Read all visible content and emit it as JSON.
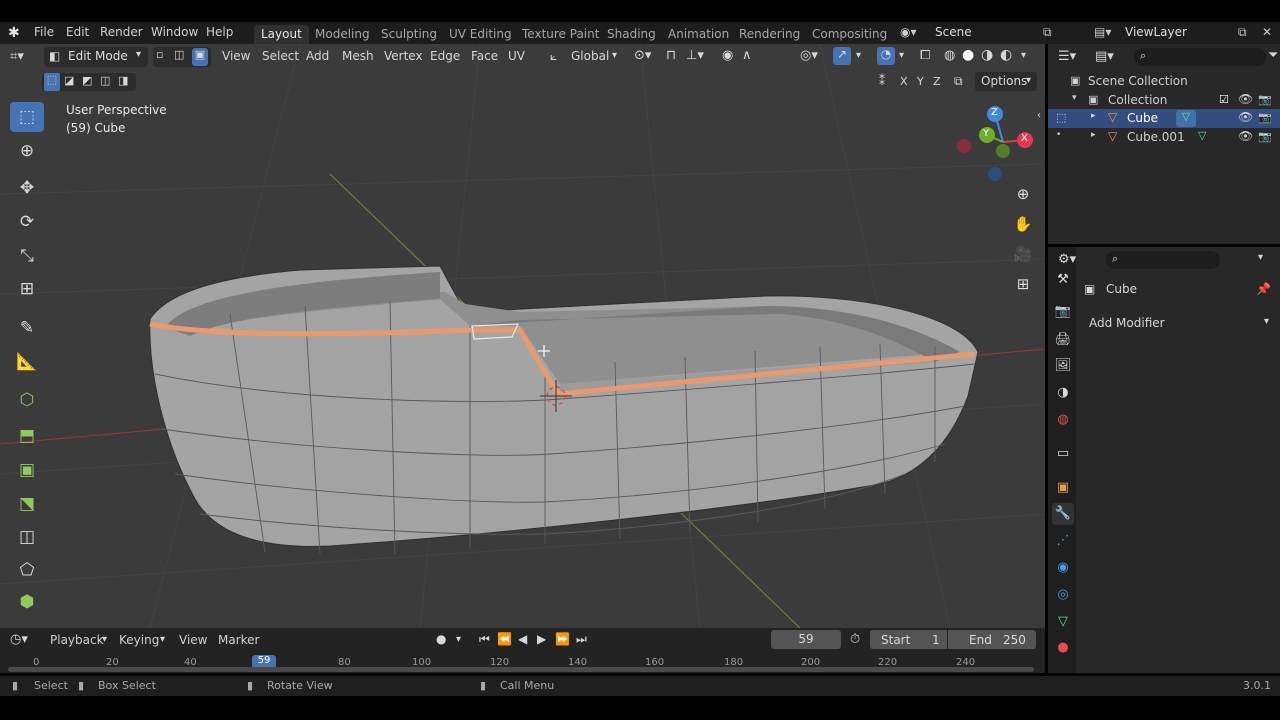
{
  "topbar": {
    "menus": [
      "File",
      "Edit",
      "Render",
      "Window",
      "Help"
    ],
    "workspaces": [
      "Layout",
      "Modeling",
      "Sculpting",
      "UV Editing",
      "Texture Paint",
      "Shading",
      "Animation",
      "Rendering",
      "Compositing"
    ],
    "active_workspace": "Layout",
    "scene": "Scene",
    "view_layer": "ViewLayer"
  },
  "viewport_header": {
    "mode": "Edit Mode",
    "menus": [
      "View",
      "Select",
      "Add",
      "Mesh",
      "Vertex",
      "Edge",
      "Face",
      "UV"
    ],
    "orientation": "Global",
    "options": "Options",
    "axes": [
      "X",
      "Y",
      "Z"
    ]
  },
  "viewport": {
    "perspective_label": "User Perspective",
    "object_label": "(59) Cube"
  },
  "gizmo": {
    "z": "Z",
    "y": "Y",
    "x": "X"
  },
  "tools": [
    "select-box",
    "cursor",
    "move",
    "rotate",
    "scale",
    "transform",
    "annotate",
    "measure",
    "add-cube",
    "extrude",
    "inset",
    "bevel",
    "loop-cut",
    "knife",
    "poly-build"
  ],
  "outliner": {
    "scene_collection": "Scene Collection",
    "collection": "Collection",
    "objects": [
      "Cube",
      "Cube.001"
    ],
    "selected": "Cube"
  },
  "properties": {
    "object_name": "Cube",
    "add_modifier": "Add Modifier"
  },
  "timeline": {
    "menus": [
      "Playback",
      "Keying",
      "View",
      "Marker"
    ],
    "current_frame": "59",
    "start_label": "Start",
    "start": "1",
    "end_label": "End",
    "end": "250",
    "ticks": [
      "0",
      "20",
      "40",
      "59",
      "80",
      "100",
      "120",
      "140",
      "160",
      "180",
      "200",
      "220",
      "240"
    ]
  },
  "statusbar": {
    "select": "Select",
    "box_select": "Box Select",
    "rotate_view": "Rotate View",
    "call_menu": "Call Menu",
    "version": "3.0.1"
  },
  "colors": {
    "accent": "#4772b3",
    "selected_edge": "#e89a6c",
    "axis_x": "#e3384f",
    "axis_y": "#6fae2d",
    "axis_z": "#3d8ae0"
  }
}
